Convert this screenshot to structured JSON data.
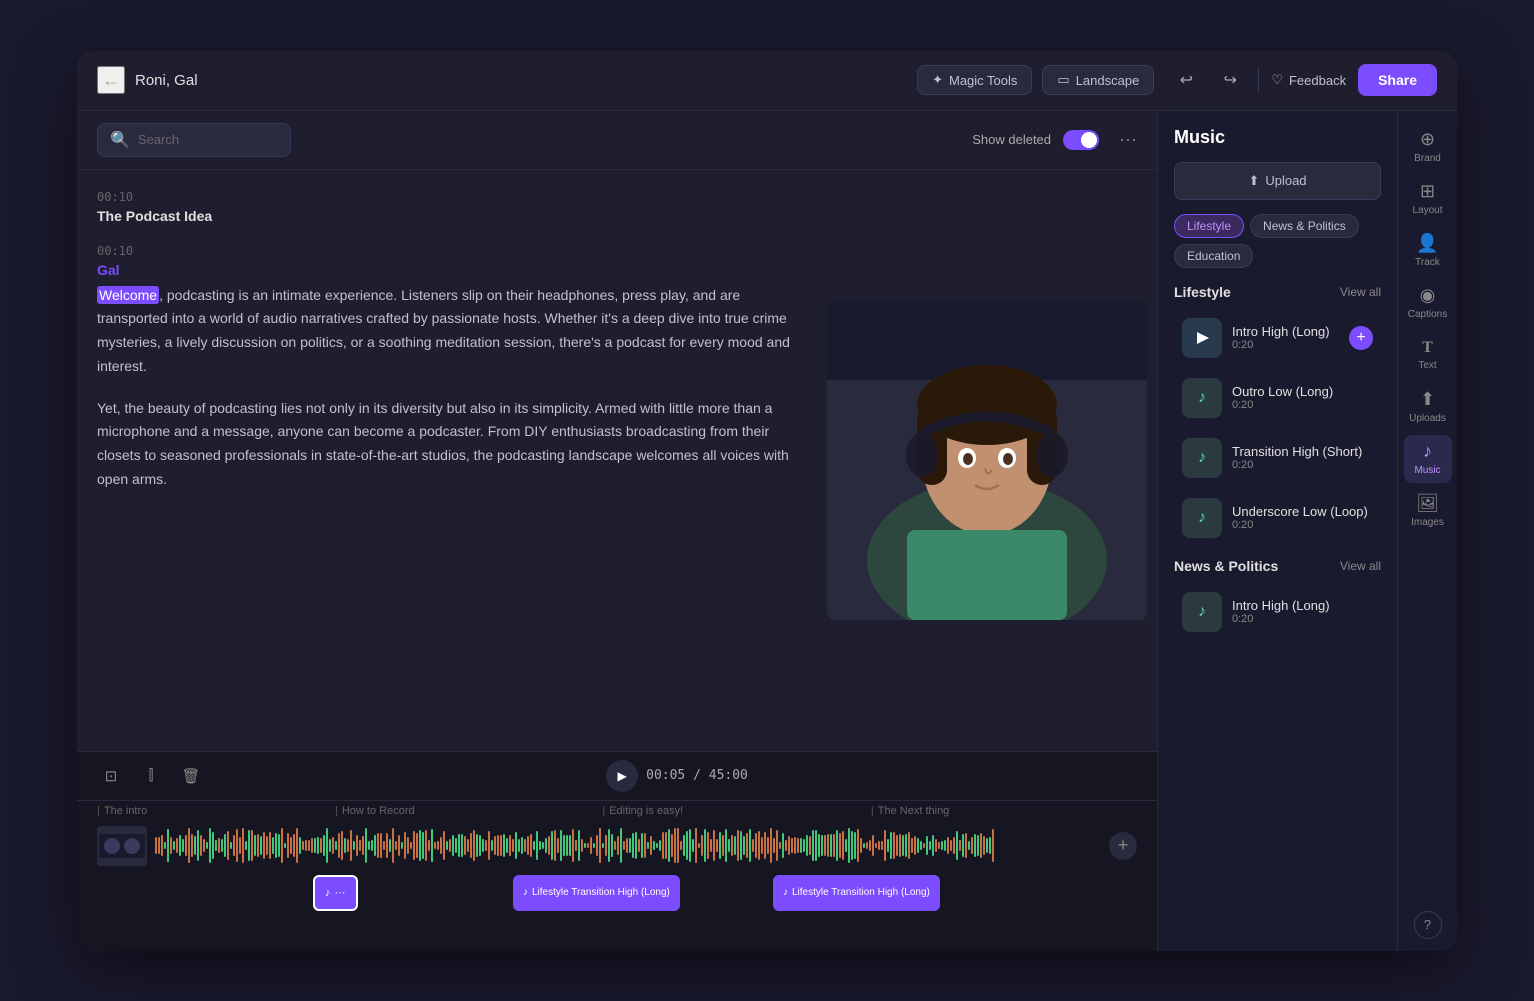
{
  "header": {
    "back_label": "←",
    "project_title": "Roni, Gal",
    "magic_tools_label": "Magic Tools",
    "landscape_label": "Landscape",
    "undo_symbol": "↩",
    "redo_symbol": "↪",
    "feedback_label": "Feedback",
    "share_label": "Share"
  },
  "toolbar": {
    "search_placeholder": "Search",
    "show_deleted_label": "Show deleted",
    "more_symbol": "···"
  },
  "transcript": {
    "entry1": {
      "timestamp": "00:10",
      "title": "The Podcast Idea"
    },
    "entry2": {
      "timestamp": "00:10",
      "speaker": "Gal",
      "highlighted_word": "Welcome",
      "body": ", podcasting is an intimate experience. Listeners slip on their headphones, press play, and are transported into a world of audio narratives crafted by passionate hosts. Whether it's a deep dive into true crime mysteries, a lively discussion on politics, or a soothing meditation session, there's a podcast for every mood and interest.",
      "body2": "Yet, the beauty of podcasting lies not only in its diversity but also in its simplicity. Armed with little more than a microphone and a message, anyone can become a podcaster. From DIY enthusiasts broadcasting from their closets to seasoned professionals in state-of-the-art studios, the podcasting landscape welcomes all voices with open arms."
    }
  },
  "player": {
    "current_time": "00:05",
    "total_time": "45:00",
    "time_display": "00:05 / 45:00"
  },
  "chapters": [
    {
      "label": "The intro"
    },
    {
      "label": "How to Record"
    },
    {
      "label": "Editing is easy!"
    },
    {
      "label": "The Next thing"
    }
  ],
  "music_panel": {
    "title": "Music",
    "upload_label": "Upload",
    "categories": [
      {
        "label": "Lifestyle",
        "active": true
      },
      {
        "label": "News & Politics",
        "active": false
      },
      {
        "label": "Education",
        "active": false
      }
    ],
    "lifestyle_section": {
      "title": "Lifestyle",
      "view_all": "View all",
      "tracks": [
        {
          "name": "Intro High (Long)",
          "duration": "0:20",
          "has_add": true
        },
        {
          "name": "Outro Low (Long)",
          "duration": "0:20",
          "has_add": false
        },
        {
          "name": "Transition High (Short)",
          "duration": "0:20",
          "has_add": false
        },
        {
          "name": "Underscore Low (Loop)",
          "duration": "0:20",
          "has_add": false
        }
      ]
    },
    "news_section": {
      "title": "News & Politics",
      "view_all": "View all",
      "tracks": [
        {
          "name": "Intro High (Long)",
          "duration": "0:20",
          "has_add": false
        }
      ]
    }
  },
  "timeline": {
    "music_clips": [
      {
        "label": "Lifestyle Transition High (Long)",
        "type": "normal",
        "offset": 360
      },
      {
        "label": "Lifestyle Transition High (Long)",
        "type": "normal",
        "offset": 450
      },
      {
        "label": "···",
        "type": "active",
        "offset": 200
      }
    ]
  },
  "tool_icons": [
    {
      "symbol": "⊕",
      "label": "Brand"
    },
    {
      "symbol": "⊞",
      "label": "Layout"
    },
    {
      "symbol": "👤",
      "label": "Track"
    },
    {
      "symbol": "◉",
      "label": "Captions"
    },
    {
      "symbol": "T",
      "label": "Text"
    },
    {
      "symbol": "↑",
      "label": "Uploads"
    },
    {
      "symbol": "♪",
      "label": "Music",
      "active": true
    },
    {
      "symbol": "🖼",
      "label": "Images"
    }
  ],
  "colors": {
    "accent": "#7c4dff",
    "bg_dark": "#1e1e2e",
    "bg_darker": "#161622",
    "border": "#2a2a3e",
    "text_muted": "#888888",
    "text_light": "#c0c0d0",
    "waveform_orange": "#e8834a",
    "waveform_green": "#4ae88a"
  }
}
